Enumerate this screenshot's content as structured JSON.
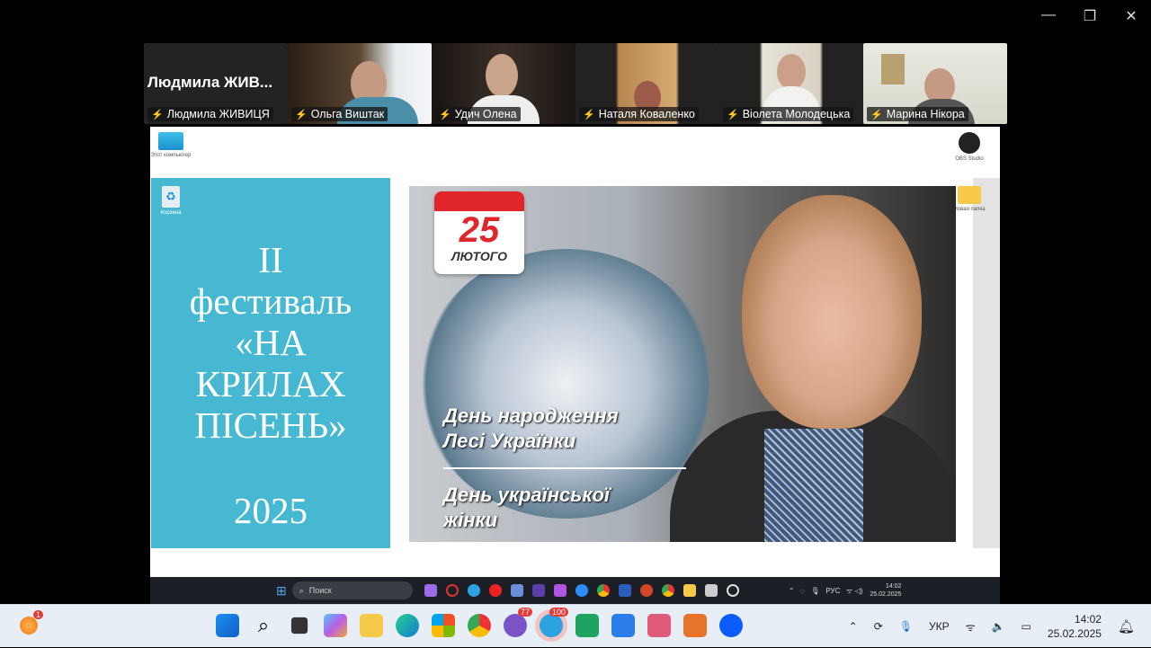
{
  "window_controls": {
    "minimize": "—",
    "restore": "❐",
    "close": "✕"
  },
  "participants": [
    {
      "name": "Людмила ЖИВИЦЯ",
      "display": "Людмила  ЖИВ...",
      "video": false
    },
    {
      "name": "Ольга Виштак",
      "video": true
    },
    {
      "name": "Удич Олена",
      "video": true
    },
    {
      "name": "Наталя Коваленко",
      "video": true
    },
    {
      "name": "Віолета Молодецька",
      "video": true,
      "active_speaker": true
    },
    {
      "name": "Марина Нікора",
      "video": true
    }
  ],
  "shared_desktop": {
    "icons": [
      "Этот компьютер",
      "Корзина",
      "OBS Studio",
      "Новая папка"
    ],
    "slide": {
      "title_lines": [
        "II",
        "фестиваль",
        "«НА",
        "КРИЛАХ",
        "ПІСЕНЬ»"
      ],
      "year": "2025",
      "calendar_day": "25",
      "calendar_month": "ЛЮТОГО",
      "caption1": [
        "День народження",
        "Лесі Українки"
      ],
      "caption2": [
        "День української",
        "жінки"
      ]
    },
    "taskbar": {
      "search_placeholder": "Поиск",
      "lang": "РУС",
      "time": "14:02",
      "date": "25.02.2025"
    }
  },
  "taskbar": {
    "notification_badge": "1",
    "viber_badge": "77",
    "telegram_badge": "100",
    "lang": "УКР",
    "time": "14:02",
    "date": "25.02.2025"
  },
  "colors": {
    "slide_panel": "#47b8d2",
    "active_speaker": "#2fd27a",
    "calendar_red": "#e0262b"
  }
}
